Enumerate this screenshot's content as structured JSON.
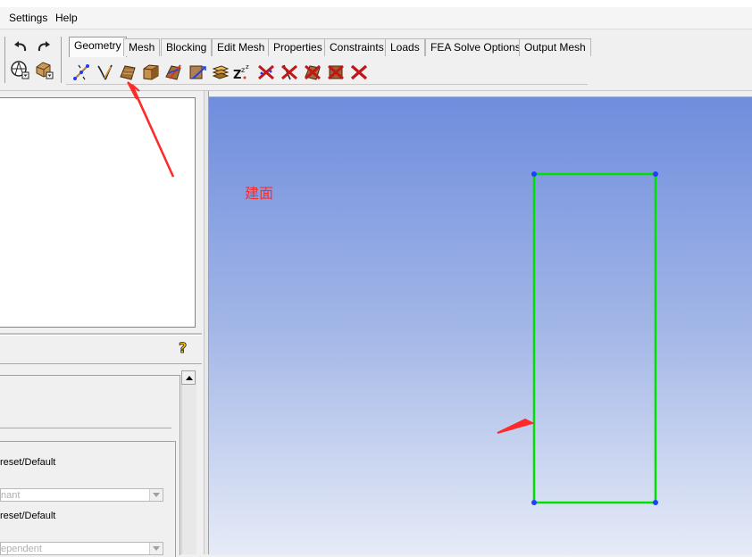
{
  "menu": {
    "settings": "Settings",
    "help": "Help"
  },
  "tabs": [
    {
      "label": "Geometry",
      "active": true
    },
    {
      "label": "Mesh"
    },
    {
      "label": "Blocking"
    },
    {
      "label": "Edit Mesh"
    },
    {
      "label": "Properties"
    },
    {
      "label": "Constraints"
    },
    {
      "label": "Loads"
    },
    {
      "label": "FEA Solve Options"
    },
    {
      "label": "Output Mesh"
    }
  ],
  "geometry_tools": [
    "create-point-icon",
    "create-curve-icon",
    "create-surface-icon",
    "create-body-icon",
    "repair-geometry-icon",
    "transform-geometry-icon",
    "restore-geometry-icon",
    "geometry-tolerance-icon",
    "delete-point-icon",
    "delete-curve-icon",
    "delete-surface-icon",
    "delete-body-icon",
    "delete-any-entity-icon"
  ],
  "form": {
    "label1": "reset/Default",
    "select1": "nant",
    "label2": "reset/Default",
    "select2": "ependent"
  },
  "viewport": {
    "annotation": "建面",
    "colors": {
      "rectangle": "#00e000",
      "vertex": "#1e40ff",
      "arrow": "#ff2a2a",
      "gradient_top": "#6f8ddd",
      "gradient_bottom": "#e6ebf7"
    }
  }
}
